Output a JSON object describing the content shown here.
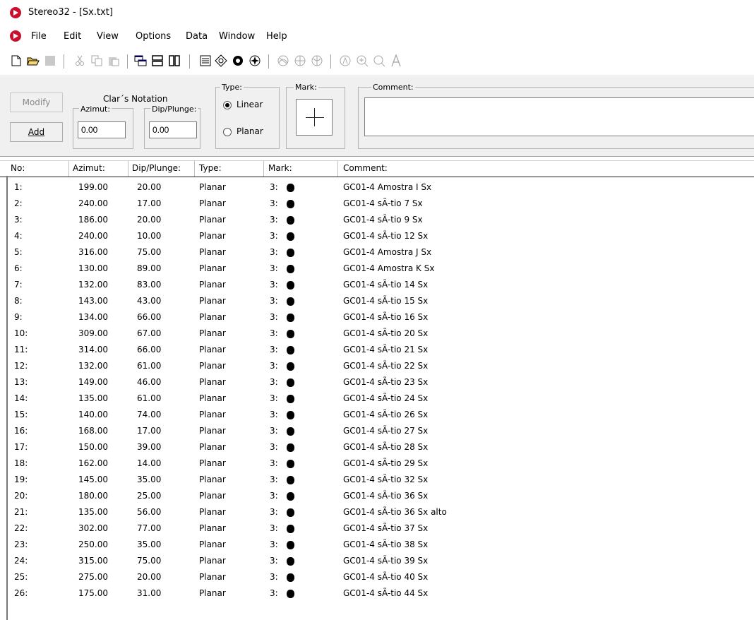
{
  "window": {
    "title": "Stereo32 - [Sx.txt]"
  },
  "menu": [
    "File",
    "Edit",
    "View",
    "Options",
    "Data",
    "Window",
    "Help"
  ],
  "panel": {
    "modify_label": "Modify",
    "add_label": "Add",
    "notation_label": "Clar´s Notation",
    "azimut_label": "Azimut:",
    "dip_label": "Dip/Plunge:",
    "azimut_value": "0.00",
    "dip_value": "0.00",
    "type_label": "Type:",
    "linear_label": "Linear",
    "planar_label": "Planar",
    "mark_label": "Mark:",
    "comment_label": "Comment:",
    "comment_value": ""
  },
  "table": {
    "headers": [
      "No:",
      "Azimut:",
      "Dip/Plunge:",
      "Type:",
      "Mark:",
      "Comment:"
    ],
    "rows": [
      {
        "no": "1:",
        "azimut": "199.00",
        "dip": "20.00",
        "type": "Planar",
        "mark": "3:",
        "comment": "GC01-4 Amostra I Sx"
      },
      {
        "no": "2:",
        "azimut": "240.00",
        "dip": "17.00",
        "type": "Planar",
        "mark": "3:",
        "comment": "GC01-4 sÃ-tio 7 Sx"
      },
      {
        "no": "3:",
        "azimut": "186.00",
        "dip": "20.00",
        "type": "Planar",
        "mark": "3:",
        "comment": "GC01-4 sÃ-tio 9 Sx"
      },
      {
        "no": "4:",
        "azimut": "240.00",
        "dip": "10.00",
        "type": "Planar",
        "mark": "3:",
        "comment": "GC01-4 sÃ-tio 12 Sx"
      },
      {
        "no": "5:",
        "azimut": "316.00",
        "dip": "75.00",
        "type": "Planar",
        "mark": "3:",
        "comment": "GC01-4 Amostra J Sx"
      },
      {
        "no": "6:",
        "azimut": "130.00",
        "dip": "89.00",
        "type": "Planar",
        "mark": "3:",
        "comment": "GC01-4 Amostra K Sx"
      },
      {
        "no": "7:",
        "azimut": "132.00",
        "dip": "83.00",
        "type": "Planar",
        "mark": "3:",
        "comment": "GC01-4 sÃ-tio 14 Sx"
      },
      {
        "no": "8:",
        "azimut": "143.00",
        "dip": "43.00",
        "type": "Planar",
        "mark": "3:",
        "comment": "GC01-4 sÃ-tio 15 Sx"
      },
      {
        "no": "9:",
        "azimut": "134.00",
        "dip": "66.00",
        "type": "Planar",
        "mark": "3:",
        "comment": "GC01-4 sÃ-tio 16 Sx"
      },
      {
        "no": "10:",
        "azimut": "309.00",
        "dip": "67.00",
        "type": "Planar",
        "mark": "3:",
        "comment": "GC01-4 sÃ-tio 20 Sx"
      },
      {
        "no": "11:",
        "azimut": "314.00",
        "dip": "66.00",
        "type": "Planar",
        "mark": "3:",
        "comment": "GC01-4 sÃ-tio 21 Sx"
      },
      {
        "no": "12:",
        "azimut": "132.00",
        "dip": "61.00",
        "type": "Planar",
        "mark": "3:",
        "comment": "GC01-4 sÃ-tio 22 Sx"
      },
      {
        "no": "13:",
        "azimut": "149.00",
        "dip": "46.00",
        "type": "Planar",
        "mark": "3:",
        "comment": "GC01-4 sÃ-tio 23 Sx"
      },
      {
        "no": "14:",
        "azimut": "135.00",
        "dip": "61.00",
        "type": "Planar",
        "mark": "3:",
        "comment": "GC01-4 sÃ-tio 24 Sx"
      },
      {
        "no": "15:",
        "azimut": "140.00",
        "dip": "74.00",
        "type": "Planar",
        "mark": "3:",
        "comment": "GC01-4 sÃ-tio 26 Sx"
      },
      {
        "no": "16:",
        "azimut": "168.00",
        "dip": "17.00",
        "type": "Planar",
        "mark": "3:",
        "comment": "GC01-4 sÃ-tio 27 Sx"
      },
      {
        "no": "17:",
        "azimut": "150.00",
        "dip": "39.00",
        "type": "Planar",
        "mark": "3:",
        "comment": "GC01-4 sÃ-tio 28 Sx"
      },
      {
        "no": "18:",
        "azimut": "162.00",
        "dip": "14.00",
        "type": "Planar",
        "mark": "3:",
        "comment": "GC01-4 sÃ-tio 29 Sx"
      },
      {
        "no": "19:",
        "azimut": "145.00",
        "dip": "35.00",
        "type": "Planar",
        "mark": "3:",
        "comment": "GC01-4 sÃ-tio 32 Sx"
      },
      {
        "no": "20:",
        "azimut": "180.00",
        "dip": "25.00",
        "type": "Planar",
        "mark": "3:",
        "comment": "GC01-4 sÃ-tio 36 Sx"
      },
      {
        "no": "21:",
        "azimut": "135.00",
        "dip": "56.00",
        "type": "Planar",
        "mark": "3:",
        "comment": "GC01-4 sÃ-tio 36 Sx alto"
      },
      {
        "no": "22:",
        "azimut": "302.00",
        "dip": "77.00",
        "type": "Planar",
        "mark": "3:",
        "comment": "GC01-4 sÃ-tio 37 Sx"
      },
      {
        "no": "23:",
        "azimut": "250.00",
        "dip": "35.00",
        "type": "Planar",
        "mark": "3:",
        "comment": "GC01-4 sÃ-tio 38 Sx"
      },
      {
        "no": "24:",
        "azimut": "315.00",
        "dip": "75.00",
        "type": "Planar",
        "mark": "3:",
        "comment": "GC01-4 sÃ-tio 39 Sx"
      },
      {
        "no": "25:",
        "azimut": "275.00",
        "dip": "20.00",
        "type": "Planar",
        "mark": "3:",
        "comment": "GC01-4 sÃ-tio 40 Sx"
      },
      {
        "no": "26:",
        "azimut": "175.00",
        "dip": "31.00",
        "type": "Planar",
        "mark": "3:",
        "comment": "GC01-4 sÃ-tio 44 Sx"
      }
    ]
  }
}
